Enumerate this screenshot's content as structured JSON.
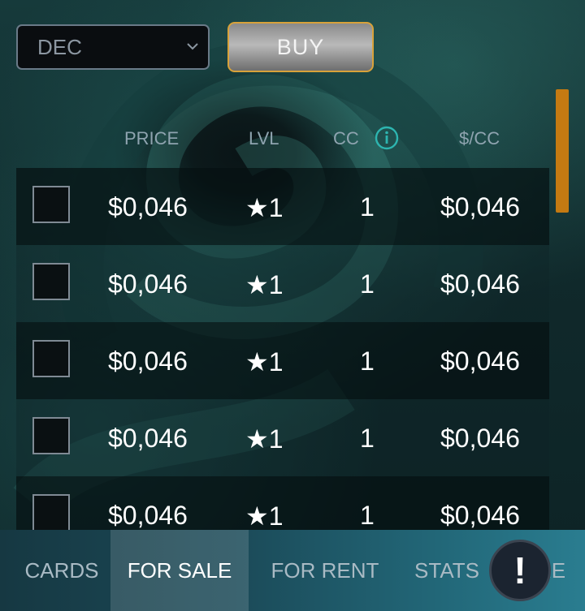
{
  "filter": {
    "selected": "DEC"
  },
  "buy_label": "BUY",
  "columns": {
    "price": "PRICE",
    "lvl": "LVL",
    "cc": "CC",
    "per_cc": "$/CC"
  },
  "rows": [
    {
      "price": "$0,046",
      "lvl": "1",
      "cc": "1",
      "per_cc": "$0,046"
    },
    {
      "price": "$0,046",
      "lvl": "1",
      "cc": "1",
      "per_cc": "$0,046"
    },
    {
      "price": "$0,046",
      "lvl": "1",
      "cc": "1",
      "per_cc": "$0,046"
    },
    {
      "price": "$0,046",
      "lvl": "1",
      "cc": "1",
      "per_cc": "$0,046"
    },
    {
      "price": "$0,046",
      "lvl": "1",
      "cc": "1",
      "per_cc": "$0,046"
    }
  ],
  "tabs": [
    {
      "label": "CARDS"
    },
    {
      "label": "FOR SALE",
      "active": true
    },
    {
      "label": "FOR RENT"
    },
    {
      "label": "STATS"
    },
    {
      "label": "RE"
    }
  ],
  "alert_symbol": "!",
  "star_glyph": "★",
  "colors": {
    "accent": "#d8a23a",
    "scrollbar": "#c47a12",
    "text": "#ffffff",
    "header": "#8fa4b0"
  }
}
